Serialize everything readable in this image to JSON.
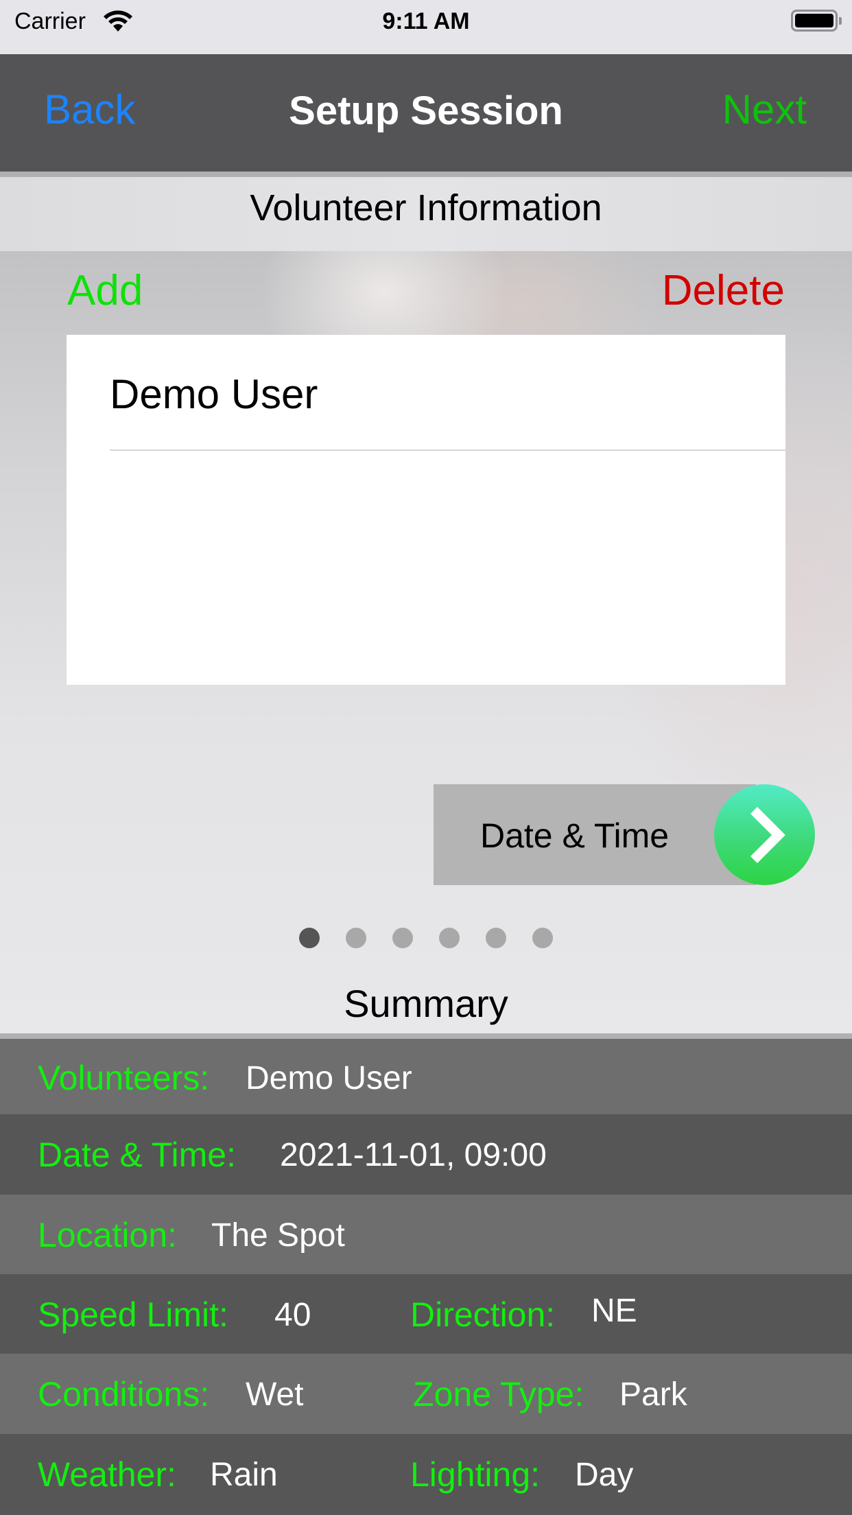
{
  "status_bar": {
    "carrier": "Carrier",
    "time": "9:11 AM",
    "wifi_icon": "wifi-icon",
    "battery_icon": "battery-full-icon"
  },
  "nav": {
    "back_label": "Back",
    "title": "Setup Session",
    "next_label": "Next",
    "colors": {
      "back": "#1b84ff",
      "next": "#0ec20b",
      "bar": "#545456"
    }
  },
  "volunteer_section": {
    "title": "Volunteer Information",
    "add_label": "Add",
    "delete_label": "Delete",
    "volunteers": [
      "Demo User"
    ],
    "colors": {
      "add": "#0fe10a",
      "delete": "#d30000"
    }
  },
  "next_step_button": {
    "label": "Date & Time",
    "icon": "chevron-right-icon"
  },
  "pager": {
    "total_pages": 6,
    "current_page": 1
  },
  "summary": {
    "title": "Summary",
    "volunteers": {
      "label": "Volunteers:",
      "value": "Demo User"
    },
    "date_time": {
      "label": "Date & Time:",
      "value": "2021-11-01, 09:00"
    },
    "location": {
      "label": "Location:",
      "value": "The Spot"
    },
    "speed_limit": {
      "label": "Speed Limit:",
      "value": "40"
    },
    "direction": {
      "label": "Direction:",
      "value": "NE"
    },
    "conditions": {
      "label": "Conditions:",
      "value": "Wet"
    },
    "zone_type": {
      "label": "Zone Type:",
      "value": "Park"
    },
    "weather": {
      "label": "Weather:",
      "value": "Rain"
    },
    "lighting": {
      "label": "Lighting:",
      "value": "Day"
    },
    "colors": {
      "label": "#13ef10",
      "value": "#ffffff"
    }
  }
}
